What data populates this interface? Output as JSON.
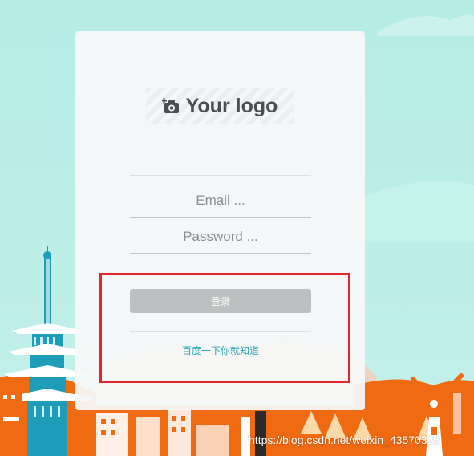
{
  "logo": {
    "text": "Your logo",
    "icon": "camera-add-icon"
  },
  "form": {
    "email_placeholder": "Email ...",
    "password_placeholder": "Password ...",
    "login_label": "登录",
    "link_text": "百度一下你就知道"
  },
  "watermark": "https://blog.csdn.net/weixin_43570325",
  "colors": {
    "sky": "#b6ece6",
    "city_orange": "#f06a12",
    "tower_blue": "#1f9cb8",
    "highlight_red": "#e0262c",
    "link": "#2ea7b5",
    "button": "#bcc0c0"
  }
}
